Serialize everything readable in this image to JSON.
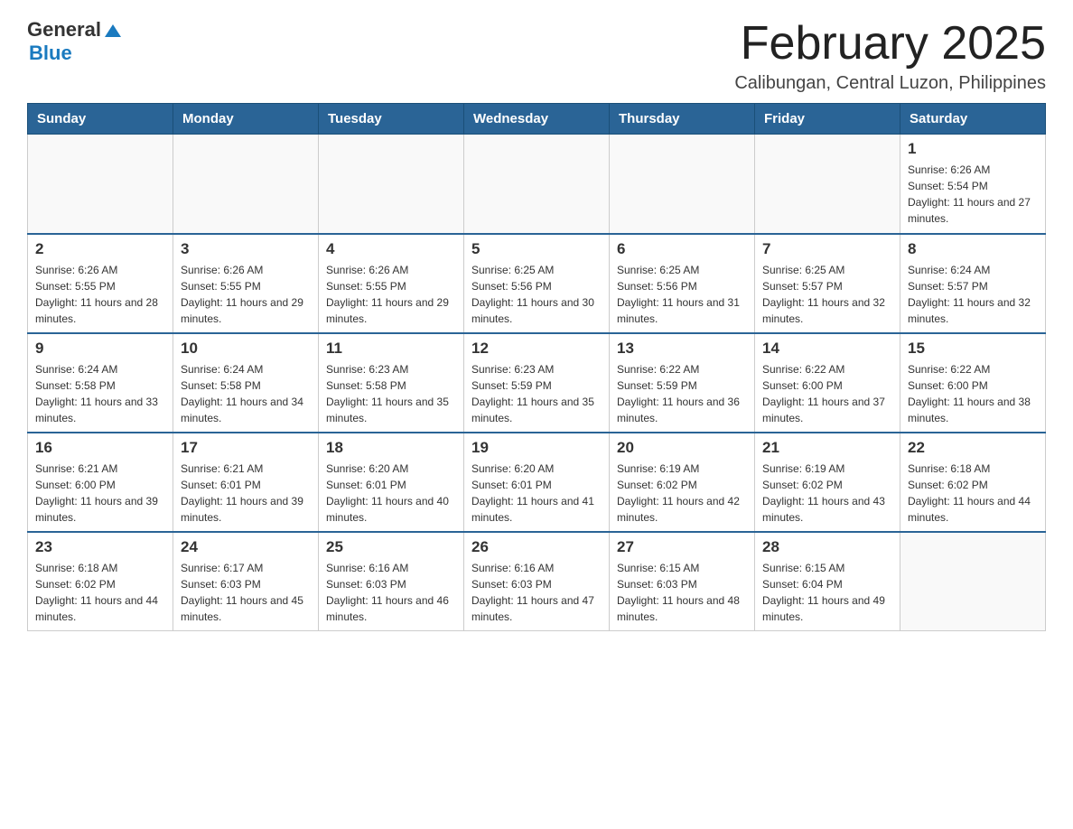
{
  "header": {
    "logo_general": "General",
    "logo_blue": "Blue",
    "month_title": "February 2025",
    "location": "Calibungan, Central Luzon, Philippines"
  },
  "days_of_week": [
    "Sunday",
    "Monday",
    "Tuesday",
    "Wednesday",
    "Thursday",
    "Friday",
    "Saturday"
  ],
  "weeks": [
    {
      "days": [
        {
          "num": "",
          "sunrise": "",
          "sunset": "",
          "daylight": ""
        },
        {
          "num": "",
          "sunrise": "",
          "sunset": "",
          "daylight": ""
        },
        {
          "num": "",
          "sunrise": "",
          "sunset": "",
          "daylight": ""
        },
        {
          "num": "",
          "sunrise": "",
          "sunset": "",
          "daylight": ""
        },
        {
          "num": "",
          "sunrise": "",
          "sunset": "",
          "daylight": ""
        },
        {
          "num": "",
          "sunrise": "",
          "sunset": "",
          "daylight": ""
        },
        {
          "num": "1",
          "sunrise": "Sunrise: 6:26 AM",
          "sunset": "Sunset: 5:54 PM",
          "daylight": "Daylight: 11 hours and 27 minutes."
        }
      ]
    },
    {
      "days": [
        {
          "num": "2",
          "sunrise": "Sunrise: 6:26 AM",
          "sunset": "Sunset: 5:55 PM",
          "daylight": "Daylight: 11 hours and 28 minutes."
        },
        {
          "num": "3",
          "sunrise": "Sunrise: 6:26 AM",
          "sunset": "Sunset: 5:55 PM",
          "daylight": "Daylight: 11 hours and 29 minutes."
        },
        {
          "num": "4",
          "sunrise": "Sunrise: 6:26 AM",
          "sunset": "Sunset: 5:55 PM",
          "daylight": "Daylight: 11 hours and 29 minutes."
        },
        {
          "num": "5",
          "sunrise": "Sunrise: 6:25 AM",
          "sunset": "Sunset: 5:56 PM",
          "daylight": "Daylight: 11 hours and 30 minutes."
        },
        {
          "num": "6",
          "sunrise": "Sunrise: 6:25 AM",
          "sunset": "Sunset: 5:56 PM",
          "daylight": "Daylight: 11 hours and 31 minutes."
        },
        {
          "num": "7",
          "sunrise": "Sunrise: 6:25 AM",
          "sunset": "Sunset: 5:57 PM",
          "daylight": "Daylight: 11 hours and 32 minutes."
        },
        {
          "num": "8",
          "sunrise": "Sunrise: 6:24 AM",
          "sunset": "Sunset: 5:57 PM",
          "daylight": "Daylight: 11 hours and 32 minutes."
        }
      ]
    },
    {
      "days": [
        {
          "num": "9",
          "sunrise": "Sunrise: 6:24 AM",
          "sunset": "Sunset: 5:58 PM",
          "daylight": "Daylight: 11 hours and 33 minutes."
        },
        {
          "num": "10",
          "sunrise": "Sunrise: 6:24 AM",
          "sunset": "Sunset: 5:58 PM",
          "daylight": "Daylight: 11 hours and 34 minutes."
        },
        {
          "num": "11",
          "sunrise": "Sunrise: 6:23 AM",
          "sunset": "Sunset: 5:58 PM",
          "daylight": "Daylight: 11 hours and 35 minutes."
        },
        {
          "num": "12",
          "sunrise": "Sunrise: 6:23 AM",
          "sunset": "Sunset: 5:59 PM",
          "daylight": "Daylight: 11 hours and 35 minutes."
        },
        {
          "num": "13",
          "sunrise": "Sunrise: 6:22 AM",
          "sunset": "Sunset: 5:59 PM",
          "daylight": "Daylight: 11 hours and 36 minutes."
        },
        {
          "num": "14",
          "sunrise": "Sunrise: 6:22 AM",
          "sunset": "Sunset: 6:00 PM",
          "daylight": "Daylight: 11 hours and 37 minutes."
        },
        {
          "num": "15",
          "sunrise": "Sunrise: 6:22 AM",
          "sunset": "Sunset: 6:00 PM",
          "daylight": "Daylight: 11 hours and 38 minutes."
        }
      ]
    },
    {
      "days": [
        {
          "num": "16",
          "sunrise": "Sunrise: 6:21 AM",
          "sunset": "Sunset: 6:00 PM",
          "daylight": "Daylight: 11 hours and 39 minutes."
        },
        {
          "num": "17",
          "sunrise": "Sunrise: 6:21 AM",
          "sunset": "Sunset: 6:01 PM",
          "daylight": "Daylight: 11 hours and 39 minutes."
        },
        {
          "num": "18",
          "sunrise": "Sunrise: 6:20 AM",
          "sunset": "Sunset: 6:01 PM",
          "daylight": "Daylight: 11 hours and 40 minutes."
        },
        {
          "num": "19",
          "sunrise": "Sunrise: 6:20 AM",
          "sunset": "Sunset: 6:01 PM",
          "daylight": "Daylight: 11 hours and 41 minutes."
        },
        {
          "num": "20",
          "sunrise": "Sunrise: 6:19 AM",
          "sunset": "Sunset: 6:02 PM",
          "daylight": "Daylight: 11 hours and 42 minutes."
        },
        {
          "num": "21",
          "sunrise": "Sunrise: 6:19 AM",
          "sunset": "Sunset: 6:02 PM",
          "daylight": "Daylight: 11 hours and 43 minutes."
        },
        {
          "num": "22",
          "sunrise": "Sunrise: 6:18 AM",
          "sunset": "Sunset: 6:02 PM",
          "daylight": "Daylight: 11 hours and 44 minutes."
        }
      ]
    },
    {
      "days": [
        {
          "num": "23",
          "sunrise": "Sunrise: 6:18 AM",
          "sunset": "Sunset: 6:02 PM",
          "daylight": "Daylight: 11 hours and 44 minutes."
        },
        {
          "num": "24",
          "sunrise": "Sunrise: 6:17 AM",
          "sunset": "Sunset: 6:03 PM",
          "daylight": "Daylight: 11 hours and 45 minutes."
        },
        {
          "num": "25",
          "sunrise": "Sunrise: 6:16 AM",
          "sunset": "Sunset: 6:03 PM",
          "daylight": "Daylight: 11 hours and 46 minutes."
        },
        {
          "num": "26",
          "sunrise": "Sunrise: 6:16 AM",
          "sunset": "Sunset: 6:03 PM",
          "daylight": "Daylight: 11 hours and 47 minutes."
        },
        {
          "num": "27",
          "sunrise": "Sunrise: 6:15 AM",
          "sunset": "Sunset: 6:03 PM",
          "daylight": "Daylight: 11 hours and 48 minutes."
        },
        {
          "num": "28",
          "sunrise": "Sunrise: 6:15 AM",
          "sunset": "Sunset: 6:04 PM",
          "daylight": "Daylight: 11 hours and 49 minutes."
        },
        {
          "num": "",
          "sunrise": "",
          "sunset": "",
          "daylight": ""
        }
      ]
    }
  ]
}
